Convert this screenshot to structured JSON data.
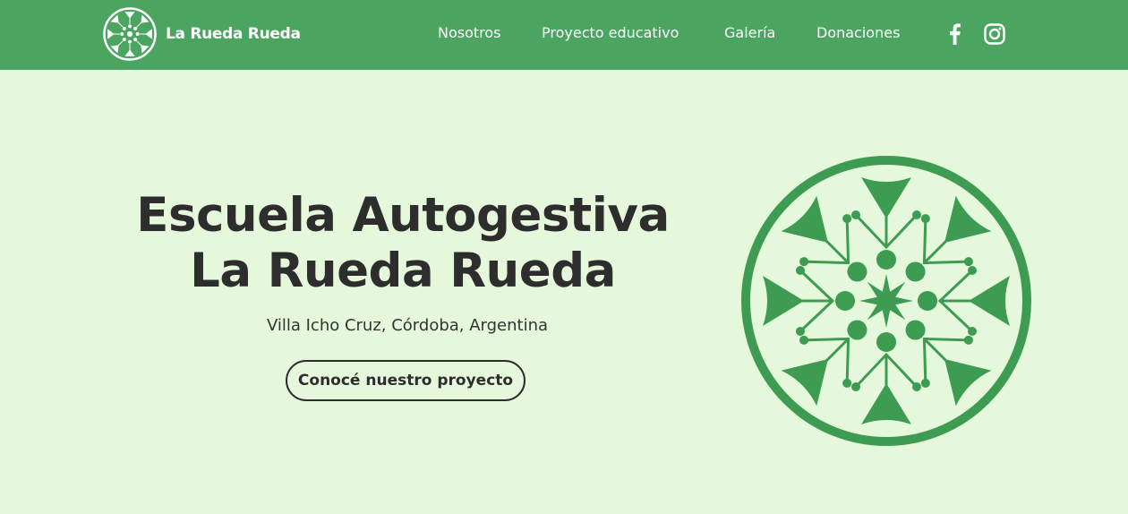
{
  "brand": {
    "name": "La Rueda Rueda",
    "logo_icon": "mandala-logo-icon"
  },
  "nav": {
    "items": [
      {
        "label": "Nosotros"
      },
      {
        "label": "Proyecto educativo"
      },
      {
        "label": "Galería"
      },
      {
        "label": "Donaciones"
      }
    ],
    "social": [
      {
        "icon": "facebook-icon"
      },
      {
        "icon": "instagram-icon"
      }
    ]
  },
  "hero": {
    "title_line1": "Escuela Autogestiva",
    "title_line2": "La Rueda Rueda",
    "subtitle": "Villa Icho Cruz, Córdoba, Argentina",
    "cta_label": "Conocé nuestro proyecto",
    "emblem_icon": "mandala-emblem-icon"
  },
  "colors": {
    "header_bg": "#4ba560",
    "page_bg": "#e5f8db",
    "emblem": "#3d9b52",
    "text": "#2d2d2d"
  }
}
